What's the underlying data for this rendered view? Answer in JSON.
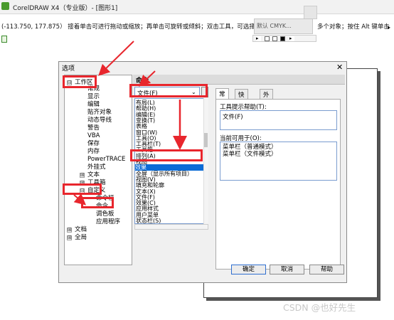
{
  "app": {
    "title": "CorelDRAW X4（专业版）- [图形1]",
    "status_text": "(-113.750, 177.875）  接着单击可进行拖动或缩放；再单击可旋转或倾斜；双击工具，可选择所有对象",
    "status_text_right": "多个对象；按住 Alt 键单击",
    "color_popup_label": "默认 CMYK...",
    "more_arrow": "▸"
  },
  "dialog": {
    "title": "选项",
    "close": "✕",
    "tree": [
      {
        "label": "工作区",
        "expander": "⊟"
      },
      {
        "label": "常规"
      },
      {
        "label": "显示"
      },
      {
        "label": "编辑"
      },
      {
        "label": "贴齐对象"
      },
      {
        "label": "动态导线"
      },
      {
        "label": "警告"
      },
      {
        "label": "VBA"
      },
      {
        "label": "保存"
      },
      {
        "label": "内存"
      },
      {
        "label": "PowerTRACE"
      },
      {
        "label": "外挂式"
      },
      {
        "label": "文本",
        "expander": "⊞"
      },
      {
        "label": "工具箱",
        "expander": "⊞"
      },
      {
        "label": "自定义",
        "expander": "⊟"
      },
      {
        "label": "命令栏"
      },
      {
        "label": "命令"
      },
      {
        "label": "调色板"
      },
      {
        "label": "应用程序"
      },
      {
        "label": "文档",
        "expander": "⊞"
      },
      {
        "label": "全局",
        "expander": "⊞"
      }
    ],
    "panel_header": "命令",
    "category_combo": "文件(F)",
    "category_options": [
      "布局(L)",
      "帮助(H)",
      "编辑(E)",
      "变换(T)",
      "表格",
      "窗口(W)",
      "工具(O)",
      "工具栏(T)",
      "工具箱",
      "排列(A)",
      "视图",
      "效果",
      "全屏（显示所有项目）",
      "视图(V)",
      "填充和轮廓",
      "文本(X)",
      "文件(F)",
      "效果(C)",
      "应用样式",
      "用户菜单",
      "状态栏(S)"
    ],
    "category_selected_index": 11,
    "tabs": [
      "常规",
      "快捷键",
      "外观"
    ],
    "active_tab": 0,
    "tooltip_label": "工具提示帮助(T):",
    "tooltip_value": "文件(F)",
    "current_label": "当前可用于(O):",
    "current_values": [
      "菜单栏（普通模式）",
      "菜单栏（文件模式）"
    ],
    "buttons": {
      "ok": "确定",
      "cancel": "取消",
      "help": "帮助"
    }
  },
  "watermark": "CSDN @也好先生",
  "colors": {
    "annotation_red": "#e8262d",
    "selection_blue": "#0b6bd6",
    "brand_green": "#4a9a2c"
  }
}
